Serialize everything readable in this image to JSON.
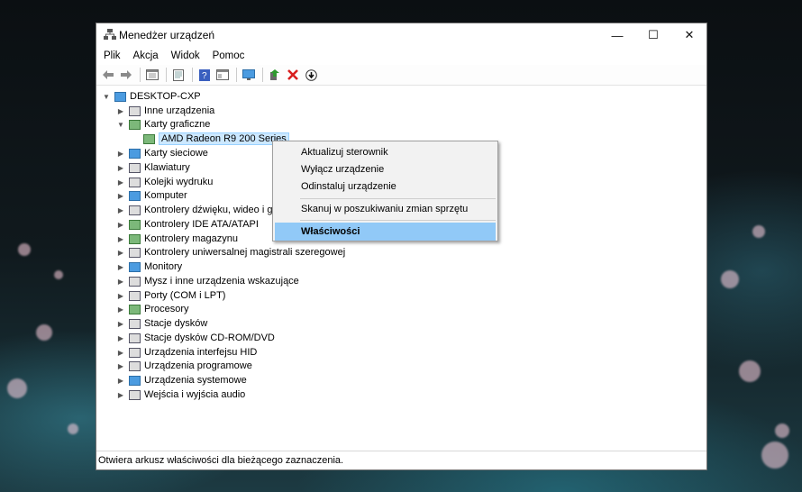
{
  "window": {
    "title": "Menedżer urządzeń",
    "controls": {
      "minimize": "—",
      "maximize": "☐",
      "close": "✕"
    }
  },
  "menu": [
    "Plik",
    "Akcja",
    "Widok",
    "Pomoc"
  ],
  "toolbar": {
    "icons": [
      "back-arrow-icon",
      "forward-arrow-icon",
      "show-hide-tree-icon",
      "properties-icon",
      "help-icon",
      "view-icon",
      "scan-monitor-icon",
      "update-driver-icon",
      "uninstall-icon",
      "disable-device-icon"
    ]
  },
  "tree": {
    "root": "DESKTOP-CXP",
    "items": [
      {
        "label": "Inne urządzenia",
        "expanded": false
      },
      {
        "label": "Karty graficzne",
        "expanded": true,
        "children": [
          {
            "label": "AMD Radeon R9 200 Series",
            "selected": true
          }
        ]
      },
      {
        "label": "Karty sieciowe",
        "expanded": false
      },
      {
        "label": "Klawiatury",
        "expanded": false
      },
      {
        "label": "Kolejki wydruku",
        "expanded": false
      },
      {
        "label": "Komputer",
        "expanded": false
      },
      {
        "label": "Kontrolery dźwięku, wideo i gier",
        "expanded": false
      },
      {
        "label": "Kontrolery IDE ATA/ATAPI",
        "expanded": false
      },
      {
        "label": "Kontrolery magazynu",
        "expanded": false
      },
      {
        "label": "Kontrolery uniwersalnej magistrali szeregowej",
        "expanded": false
      },
      {
        "label": "Monitory",
        "expanded": false
      },
      {
        "label": "Mysz i inne urządzenia wskazujące",
        "expanded": false
      },
      {
        "label": "Porty (COM i LPT)",
        "expanded": false
      },
      {
        "label": "Procesory",
        "expanded": false
      },
      {
        "label": "Stacje dysków",
        "expanded": false
      },
      {
        "label": "Stacje dysków CD-ROM/DVD",
        "expanded": false
      },
      {
        "label": "Urządzenia interfejsu HID",
        "expanded": false
      },
      {
        "label": "Urządzenia programowe",
        "expanded": false
      },
      {
        "label": "Urządzenia systemowe",
        "expanded": false
      },
      {
        "label": "Wejścia i wyjścia audio",
        "expanded": false
      }
    ]
  },
  "context_menu": {
    "items": [
      "Aktualizuj sterownik",
      "Wyłącz urządzenie",
      "Odinstaluj urządzenie",
      "Skanuj w poszukiwaniu zmian sprzętu",
      "Właściwości"
    ],
    "highlighted": "Właściwości"
  },
  "status": "Otwiera arkusz właściwości dla bieżącego zaznaczenia."
}
